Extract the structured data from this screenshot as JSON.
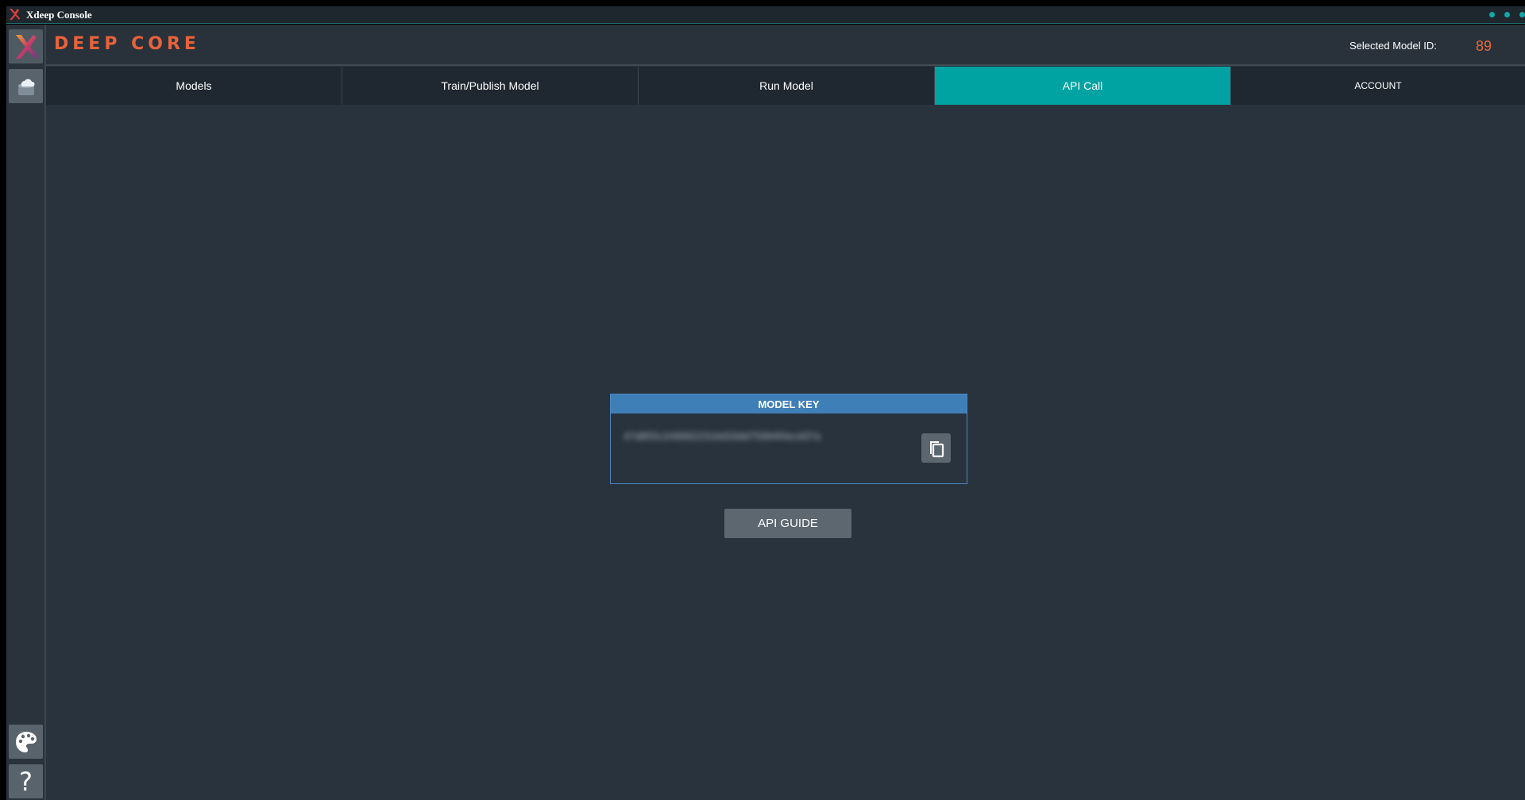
{
  "window": {
    "title": "Xdeep Console",
    "accent_color": "#00a2a2"
  },
  "sidebar": {
    "items": [
      {
        "icon": "xdeep-logo-icon"
      },
      {
        "icon": "cloud-storage-icon"
      },
      {
        "icon": "palette-icon"
      },
      {
        "icon": "help-icon",
        "glyph": "?"
      }
    ]
  },
  "header": {
    "logo_text": "DEEP CORE",
    "selected_model_label": "Selected Model ID:",
    "selected_model_value": "89"
  },
  "tabs": [
    {
      "label": "Models",
      "active": false
    },
    {
      "label": "Train/Publish Model",
      "active": false
    },
    {
      "label": "Run Model",
      "active": false
    },
    {
      "label": "API Call",
      "active": true
    },
    {
      "label": "ACCOUNT",
      "active": false
    }
  ],
  "model_key": {
    "title": "MODEL KEY",
    "value": "47d855c2499922316d33dd75994f4ecd37a",
    "copy_icon": "copy-icon"
  },
  "api_guide_label": "API GUIDE"
}
